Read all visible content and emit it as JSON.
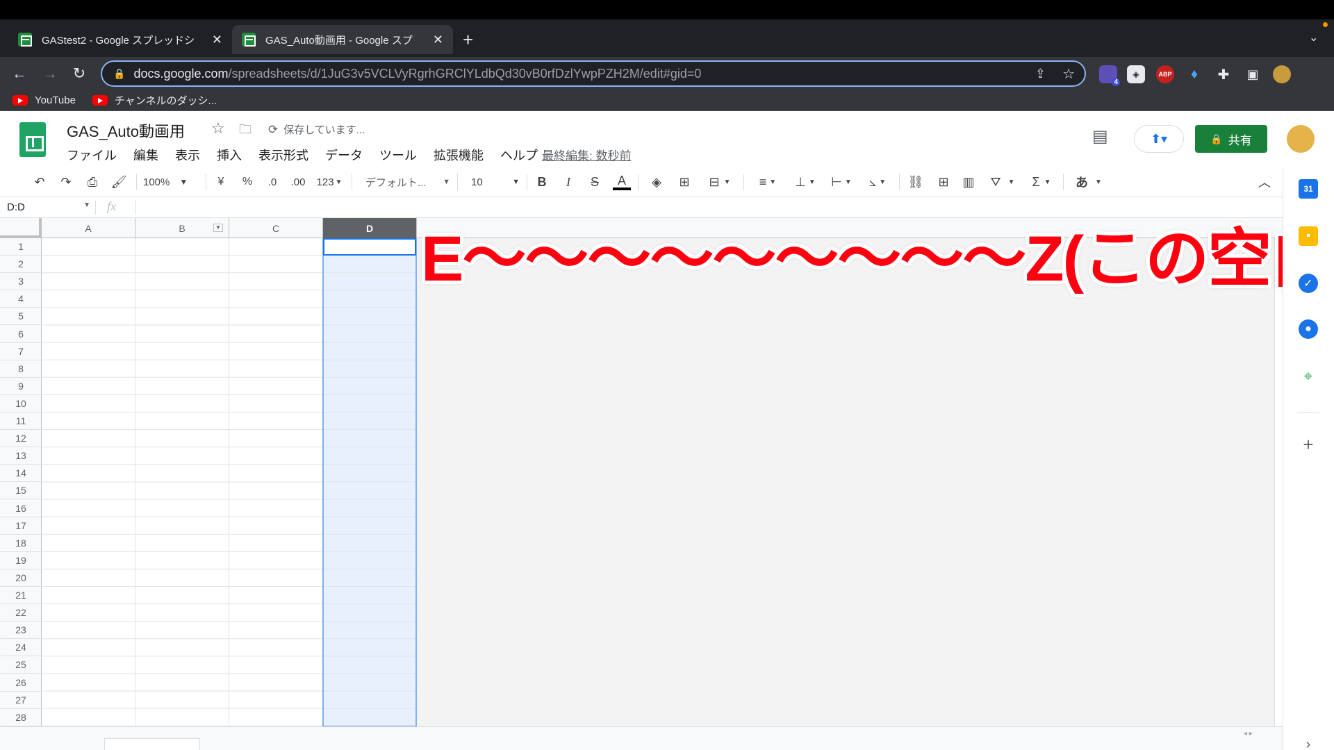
{
  "browser": {
    "tabs": [
      {
        "title": "GAStest2 - Google スプレッドシ",
        "active": false
      },
      {
        "title": "GAS_Auto動画用 - Google スプ",
        "active": true
      }
    ],
    "new_tab_icon": "plus-icon",
    "url_host": "docs.google.com",
    "url_path": "/spreadsheets/d/1JuG3v5VCLVyRgrhGRClYLdbQd30vB0rfDzlYwpPZH2M/edit#gid=0",
    "extensions": [
      "extension-badge-icon",
      "extension-icon",
      "abp-icon",
      "gem-icon",
      "puzzle-icon",
      "sidebar-icon",
      "profile-avatar"
    ],
    "extension_badge_count": "4",
    "abp_label": "ABP",
    "bookmarks": [
      "YouTube",
      "チャンネルのダッシ..."
    ]
  },
  "sheets": {
    "title": "GAS_Auto動画用",
    "saving_status": "保存しています...",
    "menu": [
      "ファイル",
      "編集",
      "表示",
      "挿入",
      "表示形式",
      "データ",
      "ツール",
      "拡張機能",
      "ヘルプ"
    ],
    "last_edit": "最終編集: 数秒前",
    "share_label": "共有",
    "toolbar": {
      "zoom": "100%",
      "currency": "¥",
      "percent": "%",
      "dec_decrease": ".0",
      "dec_increase": ".00",
      "number_format": "123",
      "font": "デフォルト...",
      "font_size": "10",
      "bold": "B",
      "italic": "I",
      "strike": "S",
      "text_color": "A",
      "input_tools": "あ"
    },
    "name_box": "D:D",
    "fx_label": "fx",
    "columns": [
      "A",
      "B",
      "C",
      "D"
    ],
    "selected_column": "D",
    "rows": [
      "1",
      "2",
      "3",
      "4",
      "5",
      "6",
      "7",
      "8",
      "9",
      "10",
      "11",
      "12",
      "13",
      "14",
      "15",
      "16",
      "17",
      "18",
      "19",
      "20",
      "21",
      "22",
      "23",
      "24",
      "25",
      "26",
      "27",
      "28"
    ],
    "calendar_day": "31"
  },
  "annotation": {
    "text": "E〜〜〜〜〜〜〜〜〜Z(この空白)",
    "color": "#ff0010"
  }
}
